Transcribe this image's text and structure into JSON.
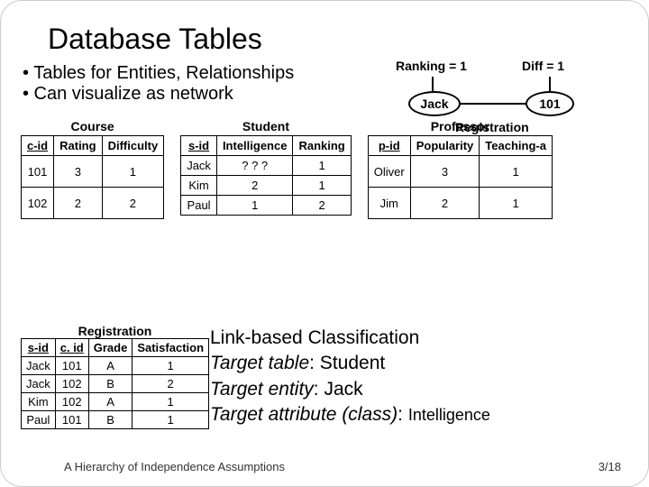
{
  "title": "Database Tables",
  "bullets": {
    "b1": "• Tables for Entities, Relationships",
    "b2": "• Can visualize as network"
  },
  "network": {
    "ranking_label": "Ranking = 1",
    "diff_label": "Diff = 1",
    "node_jack": "Jack",
    "node_101": "101",
    "edge_label": "Registration"
  },
  "course": {
    "title": "Course",
    "h1": "c-id",
    "h2": "Rating",
    "h3": "Difficulty",
    "rows": [
      {
        "c0": "101",
        "c1": "3",
        "c2": "1"
      },
      {
        "c0": "102",
        "c1": "2",
        "c2": "2"
      }
    ]
  },
  "student": {
    "title": "Student",
    "h1": "s-id",
    "h2": "Intelligence",
    "h3": "Ranking",
    "rows": [
      {
        "c0": "Jack",
        "c1": "? ? ?",
        "c2": "1"
      },
      {
        "c0": "Kim",
        "c1": "2",
        "c2": "1"
      },
      {
        "c0": "Paul",
        "c1": "1",
        "c2": "2"
      }
    ]
  },
  "professor": {
    "title": "Professor",
    "h1": "p-id",
    "h2": "Popularity",
    "h3": "Teaching-a",
    "rows": [
      {
        "c0": "Oliver",
        "c1": "3",
        "c2": "1"
      },
      {
        "c0": "Jim",
        "c1": "2",
        "c2": "1"
      }
    ]
  },
  "registration": {
    "title": "Registration",
    "h1": "s-id",
    "h2": "c. id",
    "h3": "Grade",
    "h4": "Satisfaction",
    "rows": [
      {
        "c0": "Jack",
        "c1": "101",
        "c2": "A",
        "c3": "1"
      },
      {
        "c0": "Jack",
        "c1": "102",
        "c2": "B",
        "c3": "2"
      },
      {
        "c0": "Kim",
        "c1": "102",
        "c2": "A",
        "c3": "1"
      },
      {
        "c0": "Paul",
        "c1": "101",
        "c2": "B",
        "c3": "1"
      }
    ]
  },
  "body": {
    "l1a": "Link-based Classification",
    "l2a": "Target table",
    "l2b": ": Student",
    "l3a": "Target entity",
    "l3b": ": Jack",
    "l4a": "Target attribute (class)",
    "l4b": ": ",
    "l4c": "Intelligence"
  },
  "footer": {
    "left": "A Hierarchy of Independence Assumptions",
    "right": "3/18"
  }
}
